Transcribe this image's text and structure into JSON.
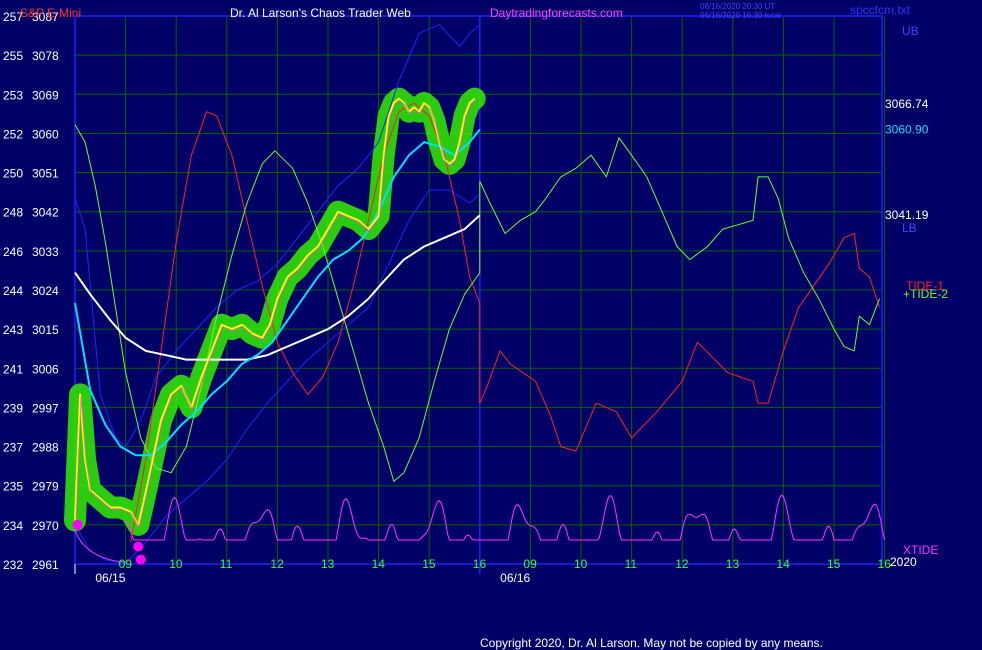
{
  "header": {
    "symbol": "S&P E-Mini",
    "title": "Dr. Al Larson's Chaos Trader Web",
    "site": "Daytradingforecasts.com",
    "stamp_line1": "06/16/2020 20:30 UT",
    "stamp_line2": "06/16/2020 16:30 local",
    "filename": "spccfcm.txt"
  },
  "footer": {
    "copyright": "Copyright 2020, Dr. Al Larson. May not be copied by any means."
  },
  "colors": {
    "background": "#000066",
    "grid": "#006400",
    "frame": "#2020ff",
    "price": "#ffff00",
    "price_halo": "#33ee00",
    "avg_fast": "#00e0ff",
    "avg_slow": "#ffffff",
    "band": "#2222ff",
    "tide1": "#ff2020",
    "tide2": "#66ff33",
    "xtide": "#ff33ff",
    "dot": "#ff00ff",
    "axis_text": "#ffffff",
    "hour_text": "#33ff33"
  },
  "chart_data": {
    "type": "line",
    "title": "Dr. Al Larson's Chaos Trader Web",
    "ylim": [
      2961,
      3087
    ],
    "price_ticks": [
      2961,
      2970,
      2979,
      2988,
      2997,
      3006,
      3015,
      3024,
      3033,
      3042,
      3051,
      3060,
      3069,
      3078,
      3087
    ],
    "left_ticks": [
      "232",
      "234",
      "235",
      "237",
      "239",
      "241",
      "243",
      "244",
      "246",
      "248",
      "250",
      "252",
      "253",
      "255",
      "257"
    ],
    "x_range": [
      0,
      16
    ],
    "hour_ticks": [
      {
        "x": 1,
        "label": "09"
      },
      {
        "x": 2,
        "label": "10"
      },
      {
        "x": 3,
        "label": "11"
      },
      {
        "x": 4,
        "label": "12"
      },
      {
        "x": 5,
        "label": "13"
      },
      {
        "x": 6,
        "label": "14"
      },
      {
        "x": 7,
        "label": "15"
      },
      {
        "x": 8,
        "label": "16"
      },
      {
        "x": 9,
        "label": "09"
      },
      {
        "x": 10,
        "label": "10"
      },
      {
        "x": 11,
        "label": "11"
      },
      {
        "x": 12,
        "label": "12"
      },
      {
        "x": 13,
        "label": "13"
      },
      {
        "x": 14,
        "label": "14"
      },
      {
        "x": 15,
        "label": "15"
      },
      {
        "x": 16,
        "label": "16"
      }
    ],
    "date_labels": [
      {
        "x": 0.6,
        "label": "06/15"
      },
      {
        "x": 8.6,
        "label": "06/16"
      }
    ],
    "year_label": "2020",
    "divider_x": 8,
    "right_labels": [
      {
        "value": 3066.74,
        "label": "3066.74",
        "color": "#ffffff"
      },
      {
        "value": 3060.9,
        "label": "3060.90",
        "color": "#00e0ff"
      },
      {
        "value": 3041.19,
        "label": "3041.19",
        "color": "#ffffff"
      }
    ],
    "series": [
      {
        "name": "price",
        "color": "#ffff00",
        "points": [
          [
            0,
            2971
          ],
          [
            0.1,
            3000
          ],
          [
            0.2,
            2985
          ],
          [
            0.3,
            2978
          ],
          [
            0.5,
            2976
          ],
          [
            0.7,
            2974
          ],
          [
            0.9,
            2974
          ],
          [
            1.1,
            2973
          ],
          [
            1.25,
            2970
          ],
          [
            1.35,
            2975
          ],
          [
            1.5,
            2983
          ],
          [
            1.7,
            2994
          ],
          [
            1.9,
            3000
          ],
          [
            2.1,
            3002
          ],
          [
            2.3,
            2997
          ],
          [
            2.5,
            3004
          ],
          [
            2.7,
            3010
          ],
          [
            2.9,
            3016
          ],
          [
            3.1,
            3015
          ],
          [
            3.3,
            3016
          ],
          [
            3.5,
            3014
          ],
          [
            3.7,
            3013
          ],
          [
            3.85,
            3016
          ],
          [
            4.0,
            3022
          ],
          [
            4.2,
            3027
          ],
          [
            4.4,
            3029
          ],
          [
            4.6,
            3032
          ],
          [
            4.8,
            3034
          ],
          [
            5.0,
            3038
          ],
          [
            5.2,
            3042
          ],
          [
            5.4,
            3041
          ],
          [
            5.6,
            3040
          ],
          [
            5.8,
            3038
          ],
          [
            6.0,
            3041
          ],
          [
            6.1,
            3055
          ],
          [
            6.2,
            3064
          ],
          [
            6.3,
            3067
          ],
          [
            6.4,
            3068
          ],
          [
            6.5,
            3067
          ],
          [
            6.6,
            3065
          ],
          [
            6.7,
            3066
          ],
          [
            6.8,
            3065
          ],
          [
            6.9,
            3067
          ],
          [
            7.0,
            3066
          ],
          [
            7.1,
            3063
          ],
          [
            7.2,
            3058
          ],
          [
            7.3,
            3054
          ],
          [
            7.4,
            3053
          ],
          [
            7.5,
            3054
          ],
          [
            7.6,
            3058
          ],
          [
            7.7,
            3064
          ],
          [
            7.8,
            3067
          ],
          [
            7.9,
            3068
          ]
        ]
      },
      {
        "name": "avg_fast",
        "color": "#00e0ff",
        "points": [
          [
            0,
            3021
          ],
          [
            0.3,
            3001
          ],
          [
            0.6,
            2993
          ],
          [
            0.9,
            2988
          ],
          [
            1.2,
            2986
          ],
          [
            1.5,
            2986
          ],
          [
            1.8,
            2989
          ],
          [
            2.1,
            2993
          ],
          [
            2.4,
            2996
          ],
          [
            2.7,
            3000
          ],
          [
            3.0,
            3003
          ],
          [
            3.3,
            3007
          ],
          [
            3.6,
            3009
          ],
          [
            3.9,
            3012
          ],
          [
            4.2,
            3017
          ],
          [
            4.5,
            3022
          ],
          [
            4.8,
            3027
          ],
          [
            5.1,
            3031
          ],
          [
            5.4,
            3033
          ],
          [
            5.7,
            3036
          ],
          [
            6.0,
            3042
          ],
          [
            6.3,
            3050
          ],
          [
            6.6,
            3055
          ],
          [
            6.9,
            3058
          ],
          [
            7.2,
            3057
          ],
          [
            7.5,
            3055
          ],
          [
            7.8,
            3058
          ],
          [
            8.0,
            3060.9
          ]
        ]
      },
      {
        "name": "avg_slow",
        "color": "#ffffff",
        "points": [
          [
            0,
            3028
          ],
          [
            0.3,
            3023
          ],
          [
            0.7,
            3017
          ],
          [
            1.0,
            3013
          ],
          [
            1.4,
            3010
          ],
          [
            1.8,
            3009
          ],
          [
            2.2,
            3008
          ],
          [
            2.6,
            3008
          ],
          [
            3.0,
            3008
          ],
          [
            3.4,
            3008
          ],
          [
            3.8,
            3009
          ],
          [
            4.2,
            3011
          ],
          [
            4.6,
            3013
          ],
          [
            5.0,
            3015
          ],
          [
            5.4,
            3018
          ],
          [
            5.8,
            3022
          ],
          [
            6.1,
            3026
          ],
          [
            6.5,
            3031
          ],
          [
            6.9,
            3034
          ],
          [
            7.3,
            3036
          ],
          [
            7.7,
            3038
          ],
          [
            8.0,
            3041.19
          ]
        ]
      },
      {
        "name": "band_upper",
        "color": "#2222ff",
        "points": [
          [
            0,
            3045
          ],
          [
            0.2,
            3038
          ],
          [
            0.5,
            3000
          ],
          [
            0.8,
            2990
          ],
          [
            1.0,
            2988
          ],
          [
            1.3,
            2994
          ],
          [
            1.6,
            3004
          ],
          [
            2.0,
            3010
          ],
          [
            2.4,
            3015
          ],
          [
            2.8,
            3020
          ],
          [
            3.2,
            3024
          ],
          [
            3.6,
            3026
          ],
          [
            4.0,
            3030
          ],
          [
            4.4,
            3036
          ],
          [
            4.8,
            3042
          ],
          [
            5.2,
            3048
          ],
          [
            5.6,
            3052
          ],
          [
            6.0,
            3058
          ],
          [
            6.4,
            3072
          ],
          [
            6.8,
            3083
          ],
          [
            7.2,
            3085
          ],
          [
            7.6,
            3080
          ],
          [
            7.8,
            3083
          ],
          [
            8.0,
            3085
          ]
        ]
      },
      {
        "name": "band_lower",
        "color": "#2222ff",
        "points": [
          [
            0,
            2970
          ],
          [
            0.3,
            2964
          ],
          [
            0.6,
            2962
          ],
          [
            1.0,
            2961
          ],
          [
            1.4,
            2966
          ],
          [
            1.8,
            2972
          ],
          [
            2.2,
            2976
          ],
          [
            2.6,
            2980
          ],
          [
            3.0,
            2985
          ],
          [
            3.4,
            2992
          ],
          [
            3.8,
            2998
          ],
          [
            4.2,
            3003
          ],
          [
            4.6,
            3008
          ],
          [
            5.0,
            3012
          ],
          [
            5.4,
            3016
          ],
          [
            5.8,
            3020
          ],
          [
            6.2,
            3030
          ],
          [
            6.6,
            3040
          ],
          [
            7.0,
            3047
          ],
          [
            7.4,
            3047
          ],
          [
            7.8,
            3044
          ],
          [
            8.0,
            3046
          ]
        ]
      },
      {
        "name": "tide1",
        "color": "#ff2020",
        "points": [
          [
            1.1,
            2966
          ],
          [
            1.4,
            2985
          ],
          [
            1.7,
            3010
          ],
          [
            2.0,
            3035
          ],
          [
            2.3,
            3055
          ],
          [
            2.6,
            3065
          ],
          [
            2.8,
            3064
          ],
          [
            3.1,
            3055
          ],
          [
            3.4,
            3040
          ],
          [
            3.7,
            3025
          ],
          [
            4.0,
            3012
          ],
          [
            4.3,
            3005
          ],
          [
            4.6,
            3000
          ],
          [
            4.9,
            3004
          ],
          [
            5.2,
            3012
          ],
          [
            5.5,
            3025
          ],
          [
            5.8,
            3040
          ],
          [
            6.1,
            3055
          ],
          [
            6.4,
            3065
          ],
          [
            6.7,
            3067
          ],
          [
            7.0,
            3064
          ],
          [
            7.3,
            3055
          ],
          [
            7.6,
            3040
          ],
          [
            7.8,
            3027
          ],
          [
            8.0,
            3021
          ],
          [
            8.0,
            2998
          ],
          [
            8.15,
            3002
          ],
          [
            8.4,
            3010
          ],
          [
            8.6,
            3007
          ],
          [
            8.85,
            3005
          ],
          [
            9.1,
            3003
          ],
          [
            9.4,
            2995
          ],
          [
            9.6,
            2988
          ],
          [
            9.9,
            2987
          ],
          [
            10.3,
            2998
          ],
          [
            10.7,
            2996
          ],
          [
            11.0,
            2990
          ],
          [
            11.5,
            2996
          ],
          [
            12.0,
            3003
          ],
          [
            12.3,
            3012
          ],
          [
            12.9,
            3005
          ],
          [
            13.4,
            3003
          ],
          [
            13.5,
            2998
          ],
          [
            13.7,
            2998
          ],
          [
            14.0,
            3010
          ],
          [
            14.3,
            3020
          ],
          [
            14.6,
            3025
          ],
          [
            14.9,
            3030
          ],
          [
            15.2,
            3036
          ],
          [
            15.4,
            3037
          ],
          [
            15.5,
            3029
          ],
          [
            15.7,
            3027
          ],
          [
            15.9,
            3020
          ]
        ]
      },
      {
        "name": "tide2",
        "color": "#66ff33",
        "points": [
          [
            0,
            3062
          ],
          [
            0.2,
            3058
          ],
          [
            0.4,
            3048
          ],
          [
            0.6,
            3035
          ],
          [
            0.8,
            3020
          ],
          [
            1.0,
            3005
          ],
          [
            1.3,
            2990
          ],
          [
            1.6,
            2983
          ],
          [
            1.9,
            2982
          ],
          [
            2.2,
            2988
          ],
          [
            2.5,
            3002
          ],
          [
            2.8,
            3018
          ],
          [
            3.1,
            3032
          ],
          [
            3.4,
            3044
          ],
          [
            3.7,
            3053
          ],
          [
            3.95,
            3056
          ],
          [
            4.3,
            3052
          ],
          [
            4.6,
            3044
          ],
          [
            4.9,
            3034
          ],
          [
            5.2,
            3022
          ],
          [
            5.5,
            3010
          ],
          [
            5.8,
            2998
          ],
          [
            6.1,
            2988
          ],
          [
            6.3,
            2980
          ],
          [
            6.5,
            2982
          ],
          [
            6.8,
            2990
          ],
          [
            7.1,
            3003
          ],
          [
            7.4,
            3015
          ],
          [
            7.7,
            3023
          ],
          [
            8.0,
            3028
          ],
          [
            8.0,
            3049
          ],
          [
            8.2,
            3044
          ],
          [
            8.5,
            3037
          ],
          [
            8.8,
            3040
          ],
          [
            9.1,
            3042
          ],
          [
            9.3,
            3045
          ],
          [
            9.6,
            3050
          ],
          [
            9.9,
            3052
          ],
          [
            10.2,
            3055
          ],
          [
            10.5,
            3050
          ],
          [
            10.75,
            3059
          ],
          [
            11.0,
            3055
          ],
          [
            11.3,
            3050
          ],
          [
            11.6,
            3042
          ],
          [
            11.9,
            3034
          ],
          [
            12.15,
            3031
          ],
          [
            12.5,
            3034
          ],
          [
            12.8,
            3038
          ],
          [
            13.1,
            3039
          ],
          [
            13.4,
            3040
          ],
          [
            13.5,
            3050
          ],
          [
            13.7,
            3050
          ],
          [
            13.9,
            3045
          ],
          [
            14.1,
            3036
          ],
          [
            14.4,
            3028
          ],
          [
            14.7,
            3022
          ],
          [
            15.0,
            3015
          ],
          [
            15.2,
            3011
          ],
          [
            15.4,
            3010
          ],
          [
            15.5,
            3018
          ],
          [
            15.7,
            3016
          ],
          [
            15.9,
            3022
          ]
        ]
      }
    ],
    "legend": [
      {
        "label": "TIDE-1",
        "color": "#ff2020"
      },
      {
        "label": "+TIDE-2",
        "color": "#66ff33"
      }
    ],
    "right_band_labels": {
      "upper": "UB",
      "lower": "LB"
    },
    "xtide_label": "XTIDE",
    "markers": [
      {
        "x": 0.05,
        "y": 2970
      },
      {
        "x": 1.25,
        "y": 2965
      },
      {
        "x": 1.3,
        "y": 2962
      }
    ]
  }
}
